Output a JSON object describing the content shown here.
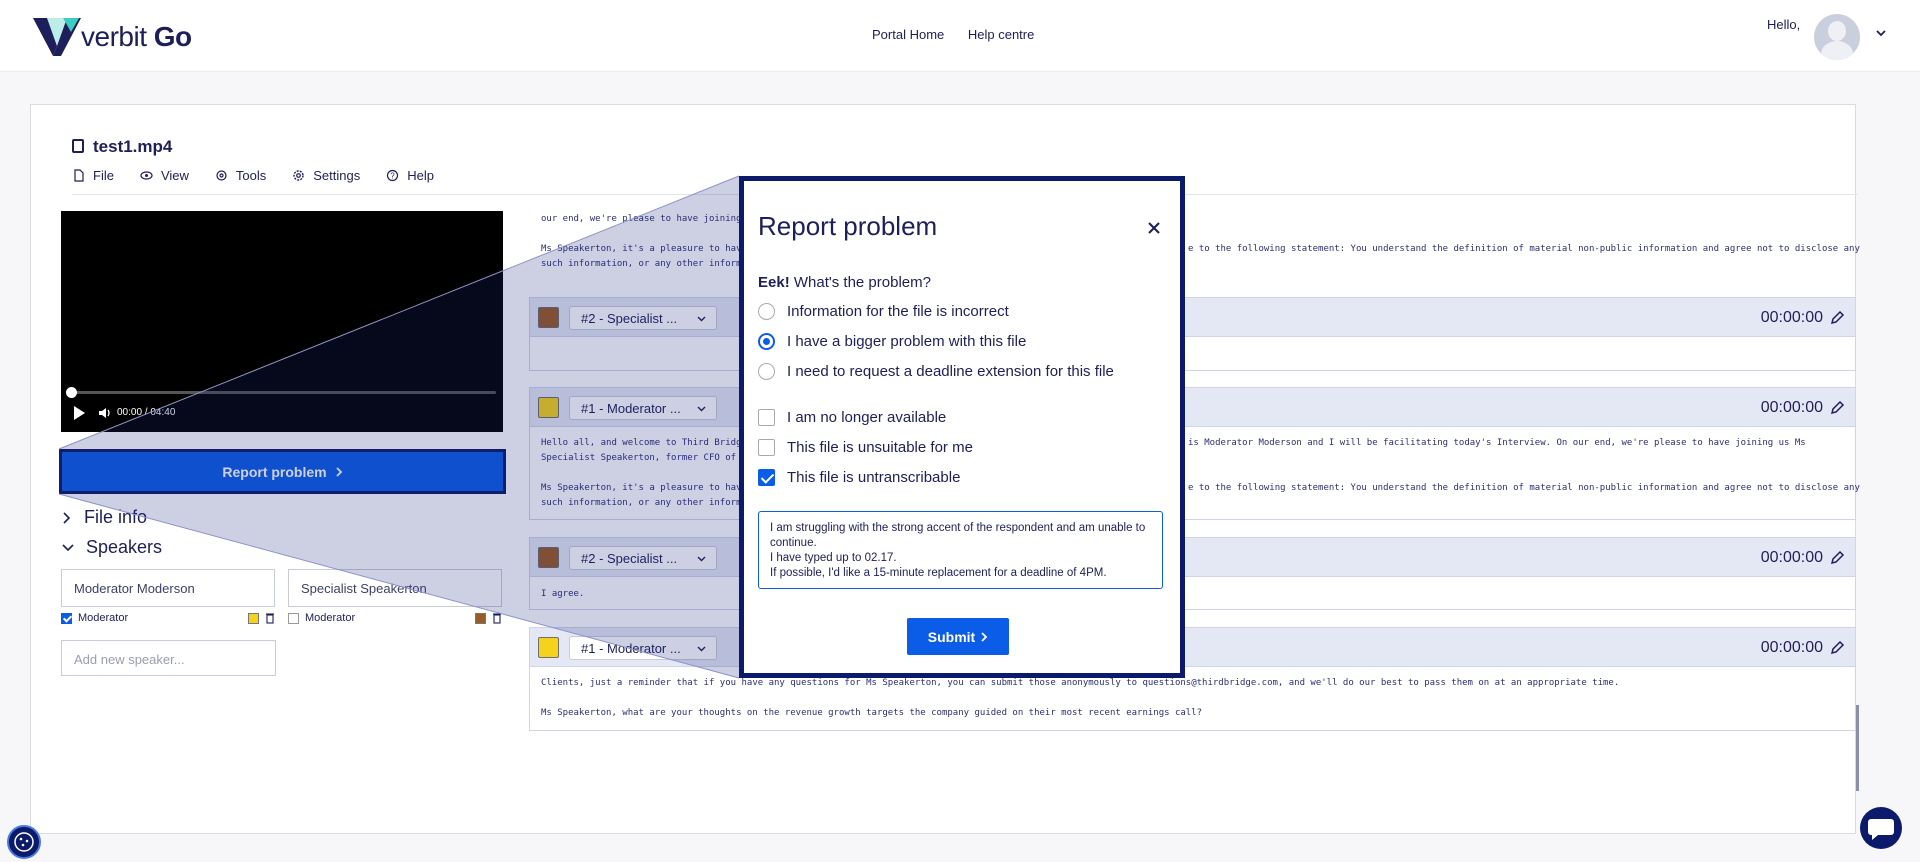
{
  "header": {
    "logo_light": "verbit",
    "logo_bold": "Go",
    "nav": [
      "Portal Home",
      "Help centre"
    ],
    "greeting": "Hello,"
  },
  "file": {
    "title": "test1.mp4",
    "menu": [
      {
        "label": "File",
        "icon": "file-icon"
      },
      {
        "label": "View",
        "icon": "eye-icon"
      },
      {
        "label": "Tools",
        "icon": "tools-icon"
      },
      {
        "label": "Settings",
        "icon": "gear-icon"
      },
      {
        "label": "Help",
        "icon": "help-icon"
      }
    ]
  },
  "video": {
    "time": "00:00 / 04:40"
  },
  "sidebar": {
    "report_button": "Report problem",
    "file_info": "File info",
    "speakers_heading": "Speakers",
    "speakers": [
      {
        "name": "Moderator Moderson",
        "role": "Moderator",
        "is_moderator": true,
        "color": "#f5d21b"
      },
      {
        "name": "Specialist Speakerton",
        "role": "Moderator",
        "is_moderator": false,
        "color": "#9b5b24"
      }
    ],
    "new_speaker_placeholder": "Add new speaker..."
  },
  "transcript": {
    "top_lines": [
      "our end, we're please to have joining",
      "",
      "Ms Speakerton, it's a pleasure to hav",
      "such information, or any other inform"
    ],
    "top_lines_right": [
      "e to the following statement: You understand the definition of material non-public information and agree not to disclose any"
    ],
    "segments": [
      {
        "speaker": "#2 - Specialist ...",
        "color": "#9b5b24",
        "time": "00:00:00",
        "lines": []
      },
      {
        "speaker": "#1 - Moderator ...",
        "color": "#f5d21b",
        "time": "00:00:00",
        "lines": [
          "Hello all, and welcome to Third Bridge",
          "Specialist Speakerton, former CFO of ",
          "",
          "Ms Speakerton, it's a pleasure to hav",
          "such information, or any other inform"
        ],
        "lines_right": [
          "is Moderator Moderson and I will be facilitating today's Interview. On our end, we're please to have joining us Ms",
          "",
          "",
          "e to the following statement: You understand the definition of material non-public information and agree not to disclose any"
        ]
      },
      {
        "speaker": "#2 - Specialist ...",
        "color": "#9b5b24",
        "time": "00:00:00",
        "lines": [
          "I agree."
        ]
      },
      {
        "speaker": "#1 - Moderator ...",
        "color": "#f5d21b",
        "time": "00:00:00",
        "lines": [
          "Clients, just a reminder that if you have any questions for Ms Speakerton, you can submit those anonymously to questions@thirdbridge.com, and we'll do our best to pass them on at an appropriate time.",
          "",
          "Ms Speakerton, what are your thoughts on the revenue growth targets the company guided on their most recent earnings call?"
        ]
      }
    ]
  },
  "dialog": {
    "title": "Report problem",
    "question_bold": "Eek!",
    "question": " What's the problem?",
    "radio_options": [
      {
        "label": "Information for the file is incorrect",
        "selected": false
      },
      {
        "label": "I have a bigger problem with this file",
        "selected": true
      },
      {
        "label": "I need to request a deadline extension for this file",
        "selected": false
      }
    ],
    "checkbox_options": [
      {
        "label": "I am no longer available",
        "checked": false
      },
      {
        "label": "This file is unsuitable for me",
        "checked": false
      },
      {
        "label": "This file is untranscribable",
        "checked": true
      }
    ],
    "message": "I am struggling with the strong accent of the respondent and am unable to continue.\nI have typed up to 02.17.\nIf possible, I'd like a 15-minute replacement for a deadline of 4PM.",
    "submit_label": "Submit"
  },
  "colors": {
    "brand": "#0b1a6b",
    "accent": "#0b5ce6",
    "logo_teal": "#3ecbc0"
  }
}
